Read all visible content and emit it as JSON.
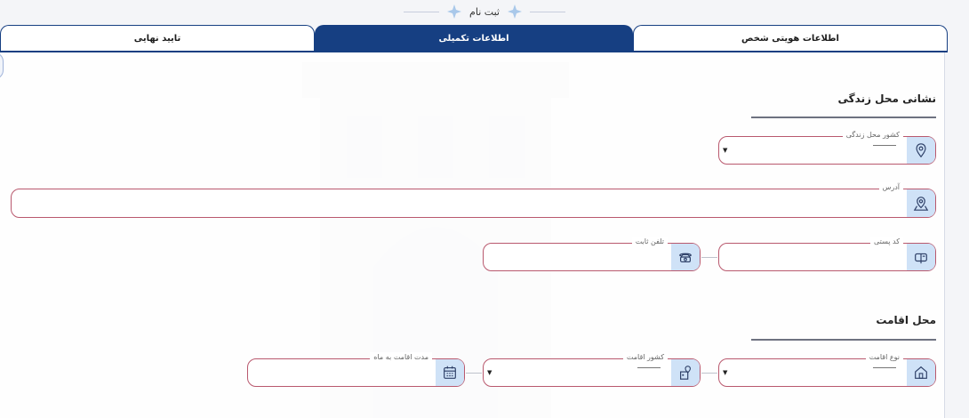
{
  "header": {
    "title": "ثبت نام"
  },
  "tabs": [
    {
      "label": "تایید نهایی"
    },
    {
      "label": "اطلاعات تکمیلی"
    },
    {
      "label": "اطلاعات هویتی شخص"
    }
  ],
  "sections": {
    "living_address": {
      "title": "نشانی محل زندگی"
    },
    "residence": {
      "title": "محل اقامت"
    }
  },
  "fields": {
    "country": {
      "label": "کشور محل زندگی",
      "icon": "map-pin-icon"
    },
    "address": {
      "label": "آدرس",
      "icon": "map-location-icon"
    },
    "postal_code": {
      "label": "کد پستی",
      "icon": "mailbox-icon"
    },
    "phone": {
      "label": "تلفن ثابت",
      "icon": "telephone-icon"
    },
    "residence_type": {
      "label": "نوع اقامت",
      "icon": "home-icon"
    },
    "residence_country": {
      "label": "کشور اقامت",
      "icon": "building-pin-icon"
    },
    "residence_duration": {
      "label": "مدت اقامت به ماه",
      "icon": "calendar-icon"
    }
  },
  "colors": {
    "primary": "#163f82",
    "field_border": "#b9596e",
    "icon_bg": "#cfe2f7"
  }
}
